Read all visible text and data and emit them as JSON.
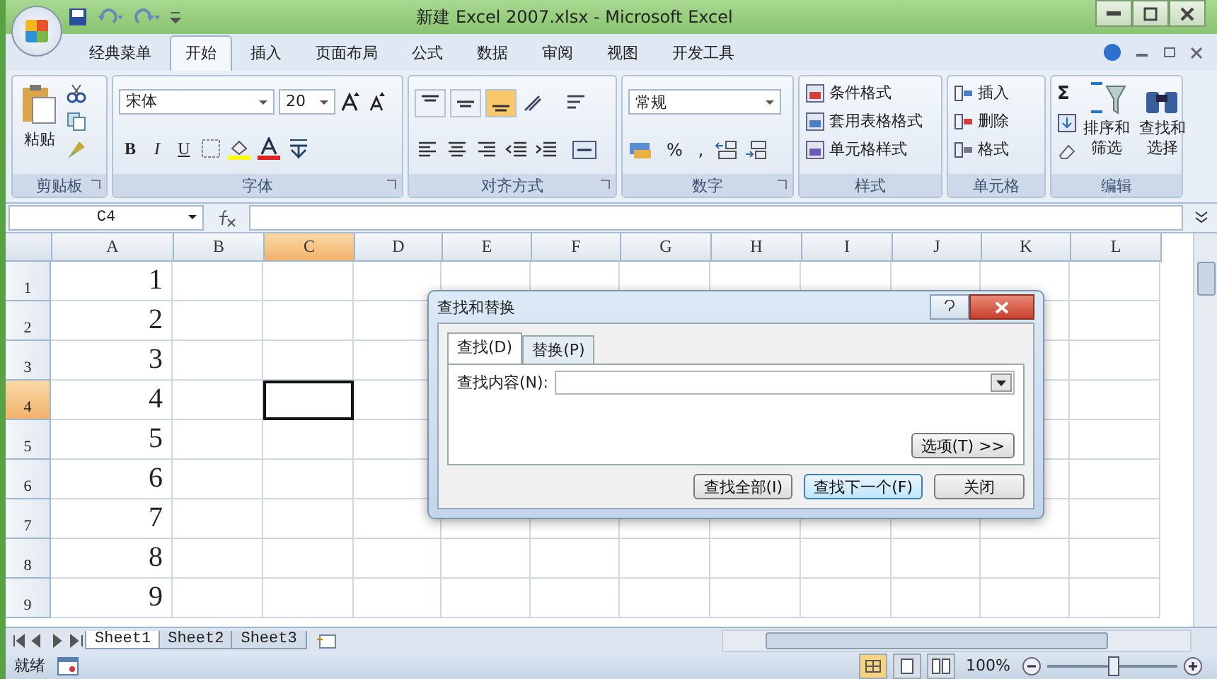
{
  "window": {
    "title": "新建 Excel 2007.xlsx - Microsoft Excel"
  },
  "tabs": [
    {
      "label": "经典菜单",
      "selected": false
    },
    {
      "label": "开始",
      "selected": true
    },
    {
      "label": "插入",
      "selected": false
    },
    {
      "label": "页面布局",
      "selected": false
    },
    {
      "label": "公式",
      "selected": false
    },
    {
      "label": "数据",
      "selected": false
    },
    {
      "label": "审阅",
      "selected": false
    },
    {
      "label": "视图",
      "selected": false
    },
    {
      "label": "开发工具",
      "selected": false
    }
  ],
  "ribbon": {
    "clipboard": {
      "label": "剪贴板",
      "paste": "粘贴"
    },
    "font": {
      "label": "字体",
      "name": "宋体",
      "size": "20",
      "styles": [
        "B",
        "I",
        "U"
      ]
    },
    "alignment": {
      "label": "对齐方式",
      "vertical": [
        {
          "kind": "top",
          "selected": false
        },
        {
          "kind": "middle",
          "selected": false
        },
        {
          "kind": "bottom",
          "selected": true
        }
      ]
    },
    "number": {
      "label": "数字",
      "format": "常规",
      "symbols": [
        "%",
        ","
      ]
    },
    "styles": {
      "label": "样式",
      "items": [
        "条件格式",
        "套用表格格式",
        "单元格样式"
      ]
    },
    "cells": {
      "label": "单元格",
      "items": [
        "插入",
        "删除",
        "格式"
      ]
    },
    "editing": {
      "label": "编辑",
      "sum": "Σ",
      "items": [
        "排序和筛选",
        "查找和选择"
      ]
    }
  },
  "formula_bar": {
    "name_box": "C4"
  },
  "grid": {
    "columns": [
      {
        "label": "A",
        "selected": false
      },
      {
        "label": "B",
        "selected": false
      },
      {
        "label": "C",
        "selected": true
      },
      {
        "label": "D",
        "selected": false
      },
      {
        "label": "E",
        "selected": false
      },
      {
        "label": "F",
        "selected": false
      },
      {
        "label": "G",
        "selected": false
      },
      {
        "label": "H",
        "selected": false
      },
      {
        "label": "I",
        "selected": false
      },
      {
        "label": "J",
        "selected": false
      },
      {
        "label": "K",
        "selected": false
      },
      {
        "label": "L",
        "selected": false
      }
    ],
    "rows": [
      {
        "label": "1",
        "selected": false,
        "value": "1"
      },
      {
        "label": "2",
        "selected": false,
        "value": "2"
      },
      {
        "label": "3",
        "selected": false,
        "value": "3"
      },
      {
        "label": "4",
        "selected": true,
        "value": "4"
      },
      {
        "label": "5",
        "selected": false,
        "value": "5"
      },
      {
        "label": "6",
        "selected": false,
        "value": "6"
      },
      {
        "label": "7",
        "selected": false,
        "value": "7"
      },
      {
        "label": "8",
        "selected": false,
        "value": "8"
      },
      {
        "label": "9",
        "selected": false,
        "value": "9"
      }
    ]
  },
  "dialog": {
    "title": "查找和替换",
    "tabs": [
      {
        "label": "查找(D)",
        "selected": true
      },
      {
        "label": "替换(P)",
        "selected": false
      }
    ],
    "field_label": "查找内容(N):",
    "options_button": "选项(T) >>",
    "buttons": [
      "查找全部(I)",
      "查找下一个(F)",
      "关闭"
    ]
  },
  "sheet_tabs": [
    {
      "label": "Sheet1",
      "selected": true
    },
    {
      "label": "Sheet2",
      "selected": false
    },
    {
      "label": "Sheet3",
      "selected": false
    }
  ],
  "status_bar": {
    "text": "就绪",
    "views": [
      {
        "kind": "normal",
        "selected": true
      },
      {
        "kind": "layout",
        "selected": false
      },
      {
        "kind": "break",
        "selected": false
      }
    ],
    "zoom": {
      "reading": "100%",
      "level": 0.5
    }
  }
}
